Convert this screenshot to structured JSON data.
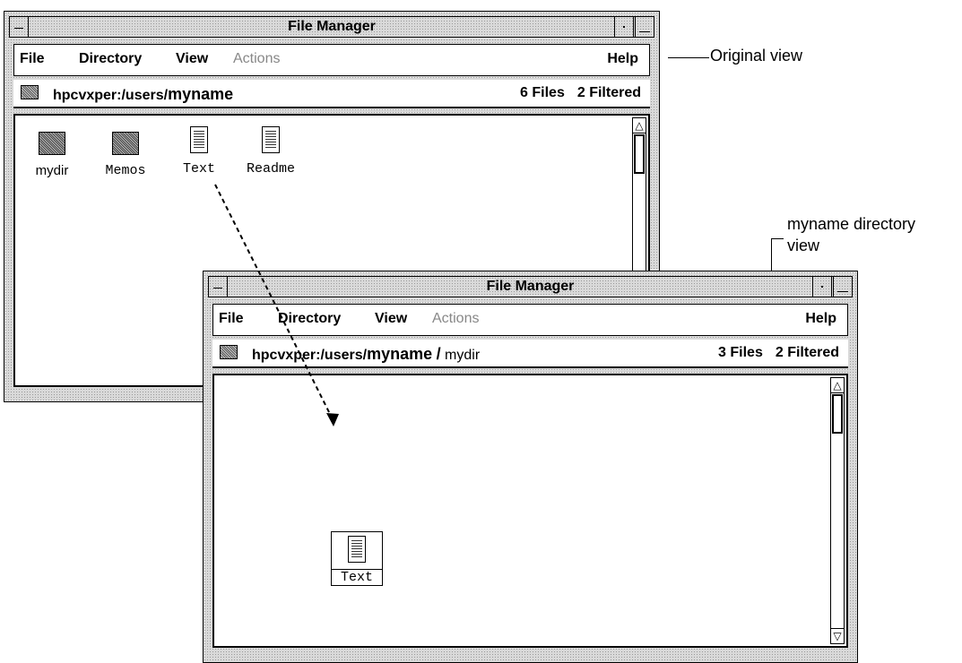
{
  "win_original": {
    "title": "File Manager",
    "menu": {
      "file": "File",
      "directory": "Directory",
      "view": "View",
      "actions": "Actions",
      "help": "Help"
    },
    "path": {
      "host": "hpcvxper:/users/",
      "dir": "myname"
    },
    "counts": {
      "files": "6 Files",
      "filtered": "2 Filtered"
    },
    "files": [
      {
        "label": "mydir",
        "icon": "folder-icon"
      },
      {
        "label": "Memos",
        "icon": "folder-icon"
      },
      {
        "label": "Text",
        "icon": "document-icon"
      },
      {
        "label": "Readme",
        "icon": "document-icon"
      }
    ]
  },
  "win_mydir": {
    "title": "File Manager",
    "menu": {
      "file": "File",
      "directory": "Directory",
      "view": "View",
      "actions": "Actions",
      "help": "Help"
    },
    "path": {
      "host": "hpcvxper:/users/",
      "dir": "myname",
      "sep": "/",
      "sub": "mydir"
    },
    "counts": {
      "files": "3 Files",
      "filtered": "2 Filtered"
    },
    "files": [
      {
        "label": "Text",
        "icon": "document-icon"
      }
    ]
  },
  "callouts": {
    "original": "Original view",
    "myname_line1": "myname directory",
    "myname_line2": "view"
  }
}
